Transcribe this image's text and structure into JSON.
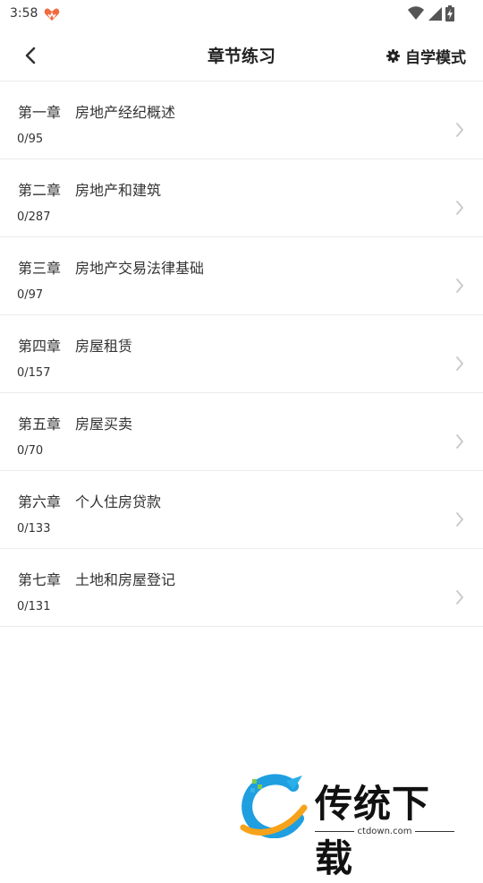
{
  "status_bar": {
    "time": "3:58"
  },
  "header": {
    "title": "章节练习",
    "mode_label": "自学模式"
  },
  "chapters": [
    {
      "title": "第一章　房地产经纪概述",
      "progress": "0/95"
    },
    {
      "title": "第二章　房地产和建筑",
      "progress": "0/287"
    },
    {
      "title": "第三章　房地产交易法律基础",
      "progress": "0/97"
    },
    {
      "title": "第四章　房屋租赁",
      "progress": "0/157"
    },
    {
      "title": "第五章　房屋买卖",
      "progress": "0/70"
    },
    {
      "title": "第六章　个人住房贷款",
      "progress": "0/133"
    },
    {
      "title": "第七章　土地和房屋登记",
      "progress": "0/131"
    }
  ],
  "watermark": {
    "name": "传统下载",
    "domain": "ctdown.com"
  },
  "icons": {
    "back": "chevron-left-icon",
    "settings": "gear-icon",
    "row": "chevron-right-icon",
    "wifi": "wifi-icon",
    "signal": "signal-icon",
    "battery": "battery-icon"
  },
  "colors": {
    "text": "#333333",
    "divider": "#ececec",
    "chevron": "#c8c8c8",
    "app_icon": "#f26a3d"
  }
}
